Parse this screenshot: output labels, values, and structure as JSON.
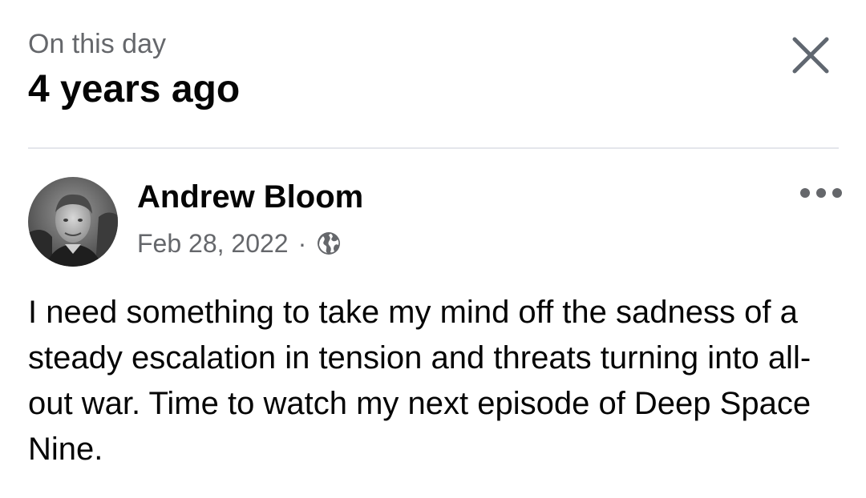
{
  "header": {
    "subtitle": "On this day",
    "title": "4 years ago",
    "close_icon": "close-icon"
  },
  "post": {
    "author": "Andrew Bloom",
    "date": "Feb 28, 2022",
    "separator": "·",
    "privacy_icon": "globe-icon",
    "more_icon": "more-horizontal-icon",
    "text": "I need something to take my mind off the sadness of a steady escalation in tension and threats turning into all-out war. Time to watch my next episode of Deep Space Nine."
  },
  "colors": {
    "text_primary": "#050505",
    "text_secondary": "#65676b",
    "divider": "#e4e6eb",
    "background": "#ffffff"
  }
}
